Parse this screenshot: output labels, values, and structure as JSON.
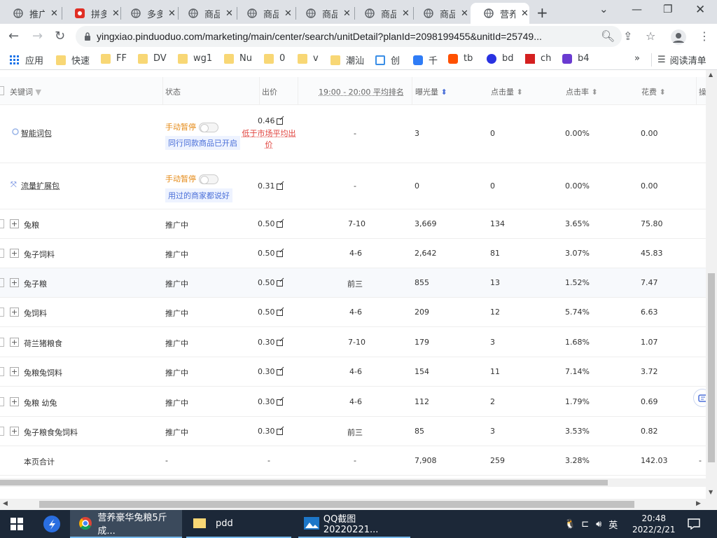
{
  "browser": {
    "tabs": [
      {
        "title": "推广",
        "icon": "globe-icon"
      },
      {
        "title": "拼多",
        "icon": "pinduoduo-icon"
      },
      {
        "title": "多多",
        "icon": "globe-icon"
      },
      {
        "title": "商品",
        "icon": "globe-icon"
      },
      {
        "title": "商品",
        "icon": "globe-icon"
      },
      {
        "title": "商品",
        "icon": "globe-icon"
      },
      {
        "title": "商品",
        "icon": "globe-icon"
      },
      {
        "title": "商品",
        "icon": "globe-icon"
      },
      {
        "title": "营养",
        "icon": "globe-icon",
        "active": true
      }
    ],
    "url": "yingxiao.pinduoduo.com/marketing/main/center/search/unitDetail?planId=2098199455&unitId=25749...",
    "bookmarks": [
      {
        "label": "应用",
        "icon": "apps-grid-icon"
      },
      {
        "label": "快速",
        "icon": "folder-icon"
      },
      {
        "label": "FF",
        "icon": "folder-icon"
      },
      {
        "label": "DV",
        "icon": "folder-icon"
      },
      {
        "label": "wg1",
        "icon": "folder-icon"
      },
      {
        "label": "Nu",
        "icon": "folder-icon"
      },
      {
        "label": "0",
        "icon": "folder-icon"
      },
      {
        "label": "v",
        "icon": "folder-icon"
      },
      {
        "label": "潮汕",
        "icon": "folder-icon"
      },
      {
        "label": "创",
        "icon": "bookmark-icon"
      },
      {
        "label": "千",
        "icon": "bookmark-icon"
      },
      {
        "label": "tb",
        "icon": "taobao-icon"
      },
      {
        "label": "bd",
        "icon": "baidu-icon"
      },
      {
        "label": "ch",
        "icon": "bookmark-icon"
      },
      {
        "label": "b4",
        "icon": "bookmark-icon"
      }
    ],
    "more_bookmarks": "»",
    "reading_list": "阅读清单"
  },
  "table": {
    "headers": {
      "keyword": "关键词",
      "status": "状态",
      "bid": "出价",
      "rank": "19:00 - 20:00 平均排名",
      "impressions": "曝光量",
      "clicks": "点击量",
      "ctr": "点击率",
      "cost": "花费",
      "extra": "操"
    },
    "special_rows": [
      {
        "keyword": "智能词包",
        "status": "手动暂停",
        "tag": "同行同款商品已开启",
        "bid": "0.46",
        "bid_warn": "低于市场平均出价",
        "rank": "-",
        "impressions": "3",
        "clicks": "0",
        "ctr": "0.00%",
        "cost": "0.00"
      },
      {
        "keyword": "流量扩展包",
        "status": "手动暂停",
        "tag": "用过的商家都说好",
        "bid": "0.31",
        "rank": "-",
        "impressions": "0",
        "clicks": "0",
        "ctr": "0.00%",
        "cost": "0.00"
      }
    ],
    "rows": [
      {
        "keyword": "兔粮",
        "status": "推广中",
        "bid": "0.50",
        "rank": "7-10",
        "impressions": "3,669",
        "clicks": "134",
        "ctr": "3.65%",
        "cost": "75.80"
      },
      {
        "keyword": "兔子饲料",
        "status": "推广中",
        "bid": "0.50",
        "rank": "4-6",
        "impressions": "2,642",
        "clicks": "81",
        "ctr": "3.07%",
        "cost": "45.83"
      },
      {
        "keyword": "兔子粮",
        "status": "推广中",
        "bid": "0.50",
        "rank": "前三",
        "impressions": "855",
        "clicks": "13",
        "ctr": "1.52%",
        "cost": "7.47"
      },
      {
        "keyword": "兔饲料",
        "status": "推广中",
        "bid": "0.50",
        "rank": "4-6",
        "impressions": "209",
        "clicks": "12",
        "ctr": "5.74%",
        "cost": "6.63"
      },
      {
        "keyword": "荷兰猪粮食",
        "status": "推广中",
        "bid": "0.30",
        "rank": "7-10",
        "impressions": "179",
        "clicks": "3",
        "ctr": "1.68%",
        "cost": "1.07"
      },
      {
        "keyword": "兔粮兔饲料",
        "status": "推广中",
        "bid": "0.30",
        "rank": "4-6",
        "impressions": "154",
        "clicks": "11",
        "ctr": "7.14%",
        "cost": "3.72"
      },
      {
        "keyword": "兔粮 幼兔",
        "status": "推广中",
        "bid": "0.30",
        "rank": "4-6",
        "impressions": "112",
        "clicks": "2",
        "ctr": "1.79%",
        "cost": "0.69"
      },
      {
        "keyword": "兔子粮食兔饲料",
        "status": "推广中",
        "bid": "0.30",
        "rank": "前三",
        "impressions": "85",
        "clicks": "3",
        "ctr": "3.53%",
        "cost": "0.82"
      }
    ],
    "totals": {
      "label": "本页合计",
      "status": "-",
      "bid": "-",
      "rank": "-",
      "impressions": "7,908",
      "clicks": "259",
      "ctr": "3.28%",
      "cost": "142.03",
      "extra": "-"
    }
  },
  "taskbar": {
    "items": [
      {
        "label": "营养豪华兔粮5斤成...",
        "icon": "chrome-icon"
      },
      {
        "label": "pdd",
        "icon": "folder-icon"
      },
      {
        "label": "QQ截图20220221...",
        "icon": "image-icon"
      }
    ],
    "ime": "英",
    "time": "20:48",
    "date": "2022/2/21"
  },
  "colors": {
    "accent_orange": "#e58a16",
    "warn_red": "#e0413b",
    "tag_blue": "#4a6fd8",
    "taskbar": "#1c2838"
  }
}
